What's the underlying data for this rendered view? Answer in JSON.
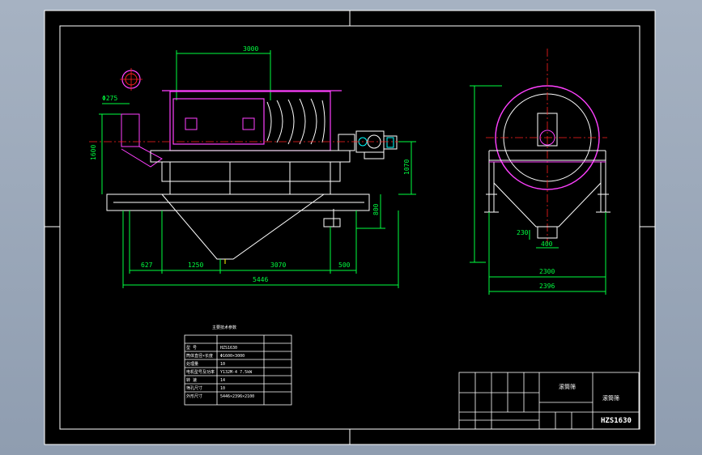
{
  "colors": {
    "paper": "#000000",
    "frame": "#ffffff",
    "dim": "#00ff40",
    "body": "#ff40ff",
    "center": "#ff2020",
    "accent": "#ffff00",
    "cyan": "#00ffff"
  },
  "dimensions": {
    "top_length": "3000",
    "pipe_dia": "Φ275",
    "left_height": "1600",
    "right_height": "1070",
    "leg_height": "800",
    "seg1": "627",
    "seg2": "1250",
    "seg3": "3070",
    "seg4": "500",
    "overall": "5446",
    "side_h": "230",
    "outlet_w": "400",
    "side_w1": "2300",
    "side_w2": "2396"
  },
  "spec_table": {
    "heading": "主要技术参数",
    "rows": [
      [
        "型    号",
        "HZS1630"
      ],
      [
        "筒体直径×长度",
        "Φ1600×3000"
      ],
      [
        "处理量",
        "10"
      ],
      [
        "电机型号及功率",
        "Y132M-4  7.5kW"
      ],
      [
        "转    速",
        "14"
      ],
      [
        "筛孔尺寸",
        "10"
      ],
      [
        "外形尺寸",
        "5446×2396×2100"
      ]
    ]
  },
  "title_block": {
    "title": "滚筒筛",
    "model": "HZS1630"
  }
}
